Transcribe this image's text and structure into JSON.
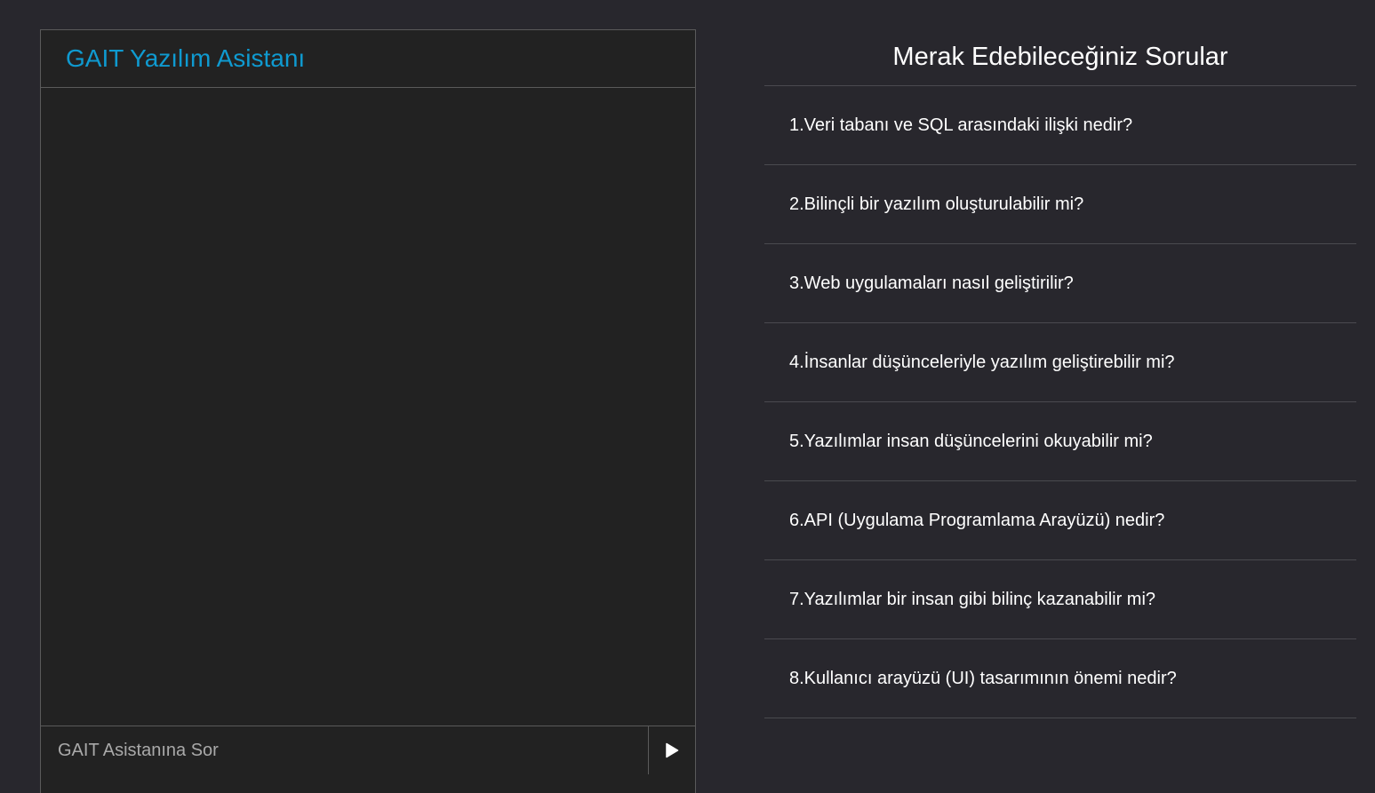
{
  "chat": {
    "title": "GAIT Yazılım Asistanı",
    "input_placeholder": "GAIT Asistanına Sor",
    "send_icon": "play-icon"
  },
  "questions": {
    "title": "Merak Edebileceğiniz Sorular",
    "items": [
      "1.Veri tabanı ve SQL arasındaki ilişki nedir?",
      "2.Bilinçli bir yazılım oluşturulabilir mi?",
      "3.Web uygulamaları nasıl geliştirilir?",
      "4.İnsanlar düşünceleriyle yazılım geliştirebilir mi?",
      "5.Yazılımlar insan düşüncelerini okuyabilir mi?",
      "6.API (Uygulama Programlama Arayüzü) nedir?",
      "7.Yazılımlar bir insan gibi bilinç kazanabilir mi?",
      "8.Kullanıcı arayüzü (UI) tasarımının önemi nedir?"
    ]
  },
  "colors": {
    "background": "#28272d",
    "panel": "#222222",
    "accent": "#0f9ad0",
    "border": "#5a5a5a"
  }
}
